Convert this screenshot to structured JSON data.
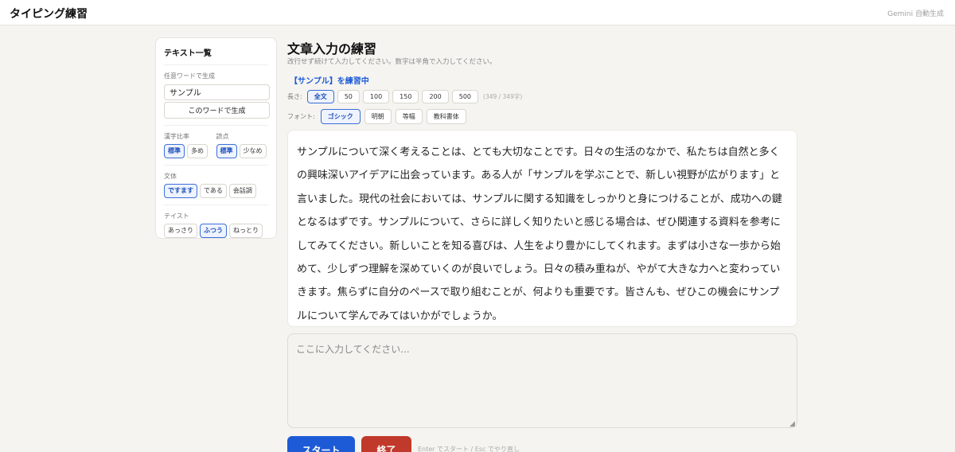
{
  "header": {
    "title": "タイピング練習",
    "note": "Gemini 自動生成"
  },
  "sidebar": {
    "title": "テキスト一覧",
    "word_label": "任意ワードで生成",
    "word_value": "サンプル",
    "generate_label": "このワードで生成",
    "kanji_label": "漢字比率",
    "kanji_options": [
      "標準",
      "多め"
    ],
    "kanji_selected": "標準",
    "comma_label": "読点",
    "comma_options": [
      "標準",
      "少なめ"
    ],
    "comma_selected": "標準",
    "style_label": "文体",
    "style_options": [
      "ですます",
      "である",
      "会話調"
    ],
    "style_selected": "ですます",
    "taste_label": "テイスト",
    "taste_options": [
      "あっさり",
      "ふつう",
      "ねっとり"
    ],
    "taste_selected": "ふつう"
  },
  "main": {
    "title": "文章入力の練習",
    "subtitle": "改行せず続けて入力してください。数字は半角で入力してください。",
    "practicing": "【サンプル】を練習中",
    "length_label": "長さ:",
    "length_options": [
      "全文",
      "50",
      "100",
      "150",
      "200",
      "500"
    ],
    "length_selected": "全文",
    "length_count": "(349 / 349字)",
    "font_label": "フォント:",
    "font_options": [
      "ゴシック",
      "明朝",
      "等幅",
      "教科書体"
    ],
    "font_selected": "ゴシック",
    "text": "サンプルについて深く考えることは、とても大切なことです。日々の生活のなかで、私たちは自然と多くの興味深いアイデアに出会っています。ある人が「サンプルを学ぶことで、新しい視野が広がります」と言いました。現代の社会においては、サンプルに関する知識をしっかりと身につけることが、成功への鍵となるはずです。サンプルについて、さらに詳しく知りたいと感じる場合は、ぜひ関連する資料を参考にしてみてください。新しいことを知る喜びは、人生をより豊かにしてくれます。まずは小さな一歩から始めて、少しずつ理解を深めていくのが良いでしょう。日々の積み重ねが、やがて大きな力へと変わっていきます。焦らずに自分のペースで取り組むことが、何よりも重要です。皆さんも、ぜひこの機会にサンプルについて学んでみてはいかがでしょうか。",
    "input_placeholder": "ここに入力してください...",
    "start_label": "スタート",
    "end_label": "終了",
    "hint": "Enter でスタート / Esc でやり直し"
  },
  "colors": {
    "accent": "#1d5bd6",
    "danger": "#c0392b",
    "background": "#f5f4f0"
  }
}
